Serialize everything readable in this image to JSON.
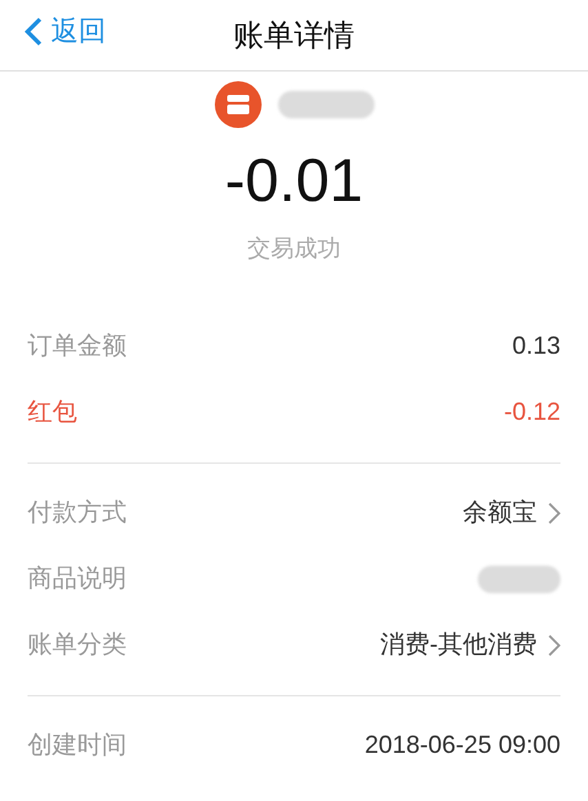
{
  "nav": {
    "back": "返回",
    "title": "账单详情"
  },
  "merchant": {
    "name_redacted": true
  },
  "amount": "-0.01",
  "status": "交易成功",
  "sections": [
    {
      "rows": [
        {
          "label": "订单金额",
          "value": "0.13",
          "kind": "text",
          "alert": false
        },
        {
          "label": "红包",
          "value": "-0.12",
          "kind": "text",
          "alert": true
        }
      ]
    },
    {
      "rows": [
        {
          "label": "付款方式",
          "value": "余额宝",
          "kind": "link",
          "alert": false
        },
        {
          "label": "商品说明",
          "kind": "redacted",
          "alert": false
        },
        {
          "label": "账单分类",
          "value": "消费-其他消费",
          "kind": "link",
          "alert": false
        }
      ]
    },
    {
      "rows": [
        {
          "label": "创建时间",
          "value": "2018-06-25 09:00",
          "kind": "text",
          "alert": false
        }
      ]
    }
  ]
}
